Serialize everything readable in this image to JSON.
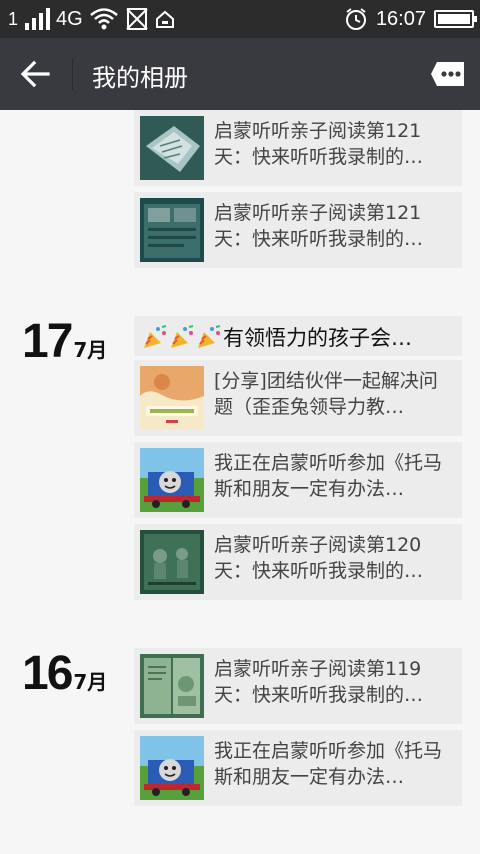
{
  "status_bar": {
    "network": "4G",
    "time": "16:07",
    "battery_level": 1.0,
    "icons": [
      "sim-1-icon",
      "signal-icon",
      "wifi-icon",
      "no-sim-icon",
      "home-icon",
      "alarm-icon",
      "battery-icon"
    ]
  },
  "header": {
    "title": "我的相册",
    "back_icon": "back-arrow-icon",
    "more_icon": "more-icon"
  },
  "groups": [
    {
      "day": "",
      "month": "",
      "posts": [
        {
          "kind": "card",
          "thumb": "book-page-photo",
          "text": "启蒙听听亲子阅读第121天：快来听听我录制的…"
        },
        {
          "kind": "card",
          "thumb": "book-page-photo-dark",
          "text": "启蒙听听亲子阅读第121天：快来听听我录制的…"
        }
      ]
    },
    {
      "day": "17",
      "month": "7月",
      "posts": [
        {
          "kind": "text",
          "emoji": [
            "party-popper-icon",
            "party-popper-icon",
            "party-popper-icon"
          ],
          "text": "有领悟力的孩子会…"
        },
        {
          "kind": "card",
          "thumb": "picture-book-cover",
          "text": "[分享]团结伙伴一起解决问题（歪歪兔领导力教…"
        },
        {
          "kind": "card",
          "thumb": "thomas-train-photo",
          "text": "我正在启蒙听听参加《托马斯和朋友一定有办法…"
        },
        {
          "kind": "card",
          "thumb": "book-page-photo-dark",
          "text": "启蒙听听亲子阅读第120天：快来听听我录制的…"
        }
      ]
    },
    {
      "day": "16",
      "month": "7月",
      "posts": [
        {
          "kind": "card",
          "thumb": "book-page-photo-green",
          "text": "启蒙听听亲子阅读第119天：快来听听我录制的…"
        },
        {
          "kind": "card",
          "thumb": "thomas-train-photo",
          "text": "我正在启蒙听听参加《托马斯和朋友一定有办法…"
        }
      ]
    }
  ]
}
